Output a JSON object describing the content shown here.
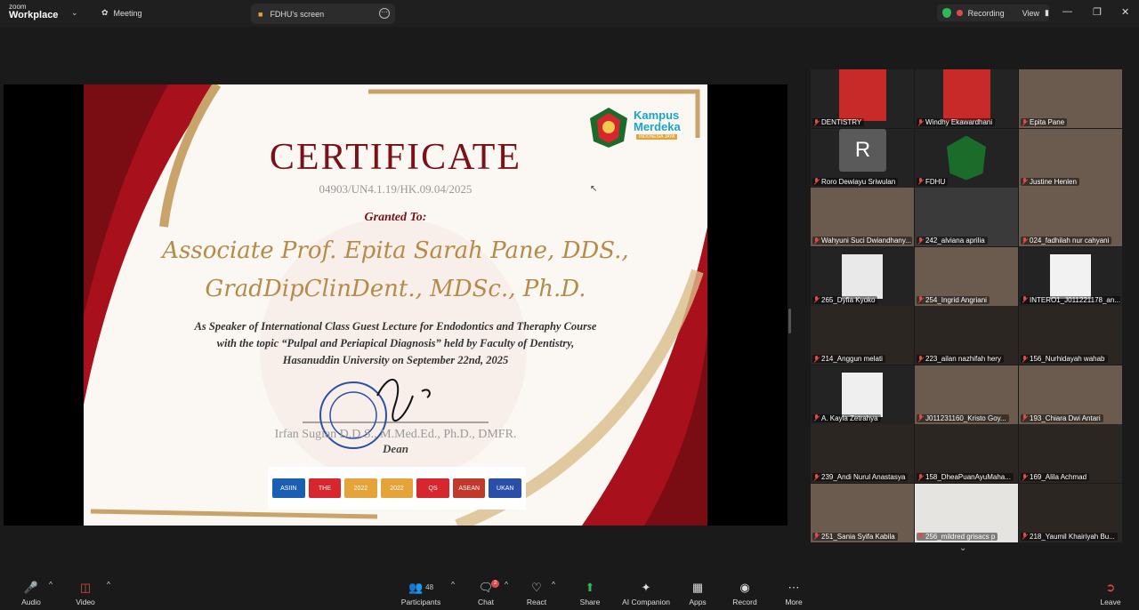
{
  "app": {
    "zoom_label": "zoom",
    "workplace_label": "Workplace"
  },
  "meeting_tab": "Meeting",
  "screen_tab": "FDHU's screen",
  "recording": {
    "label": "Recording",
    "view_label": "View"
  },
  "certificate": {
    "title": "CERTIFICATE",
    "number": "04903/UN4.1.19/HK.09.04/2025",
    "granted": "Granted To:",
    "name_line1": "Associate Prof. Epita Sarah Pane, DDS.,",
    "name_line2": "GradDipClinDent., MDSc., Ph.D.",
    "desc_line1": "As Speaker of  International Class Guest Lecture for Endodontics and Theraphy Course",
    "desc_line2": "with the topic “Pulpal and Periapical Diagnosis” held by Faculty of Dentistry,",
    "desc_line3": "Hasanuddin University on September 22nd, 2025",
    "signer": "Irfan Sugian   D.D.S., M.Med.Ed., Ph.D., DMFR.",
    "role": "Dean",
    "kampus_line1": "Kampus",
    "kampus_line2": "Merdeka",
    "kampus_sub": "INDONESIA JAYA",
    "logo_labels": [
      "ASIIN",
      "THE",
      "2022",
      "2022",
      "QS",
      "ASEAN",
      "UKAN"
    ]
  },
  "participants": [
    {
      "name": "DENTISTRY",
      "photo": "person"
    },
    {
      "name": "Windhy Ekawardhani",
      "photo": "person"
    },
    {
      "name": "Epita Pane",
      "photo": "person"
    },
    {
      "name": "Roro Dewiayu Sriwulan",
      "photo": "avatar-r"
    },
    {
      "name": "FDHU",
      "photo": "emblem"
    },
    {
      "name": "Justine Henlen",
      "photo": "person"
    },
    {
      "name": "Wahyuni Suci Dwiandhany...",
      "photo": "person"
    },
    {
      "name": "242_alviana aprilia",
      "photo": "room"
    },
    {
      "name": "024_fadhilah nur cahyani",
      "photo": "person"
    },
    {
      "name": "265_Dyfia Kyoko",
      "photo": "slide"
    },
    {
      "name": "254_Ingrid Angriani",
      "photo": "person"
    },
    {
      "name": "INTERO1_J011221178_an...",
      "photo": "slide2"
    },
    {
      "name": "214_Anggun melati",
      "photo": "dark"
    },
    {
      "name": "223_ailan nazhifah hery",
      "photo": "dark"
    },
    {
      "name": "156_Nurhidayah wahab",
      "photo": "dark"
    },
    {
      "name": "A. Kayla Zetrahya",
      "photo": "slide3"
    },
    {
      "name": "J011231160_Kristo Goy...",
      "photo": "person"
    },
    {
      "name": "193_Chiara Dwi Antari",
      "photo": "person"
    },
    {
      "name": "239_Andi Nurul Anastasya",
      "photo": "dark"
    },
    {
      "name": "158_DheaPuanAyuMaha...",
      "photo": "dark"
    },
    {
      "name": "169_Alila Achmad",
      "photo": "dark"
    },
    {
      "name": "251_Sania Syifa Kabila",
      "photo": "person"
    },
    {
      "name": "256_mildred grisacs p",
      "photo": "light"
    },
    {
      "name": "218_Yaumil Khairiyah Bu...",
      "photo": "dark"
    }
  ],
  "avatar_letter": "R",
  "toolbar": {
    "audio": "Audio",
    "video": "Video",
    "participants": "Participants",
    "participants_count": "48",
    "chat": "Chat",
    "chat_badge": "2",
    "react": "React",
    "share": "Share",
    "ai_companion": "AI Companion",
    "apps": "Apps",
    "record": "Record",
    "more": "More",
    "leave": "Leave"
  },
  "colors": {
    "accent_green": "#2fb85a",
    "danger_red": "#e24a4a",
    "cert_maroon": "#7a1018",
    "cert_gold": "#b58b4a"
  }
}
